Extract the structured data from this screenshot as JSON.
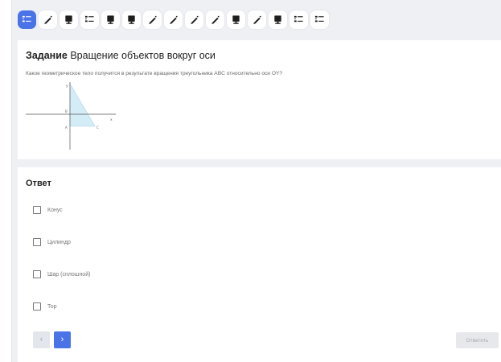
{
  "toolbar": {
    "tools": [
      {
        "icon": "checklist-icon",
        "active": true
      },
      {
        "icon": "pen-icon",
        "active": false
      },
      {
        "icon": "monitor-icon",
        "active": false
      },
      {
        "icon": "checklist-icon",
        "active": false
      },
      {
        "icon": "monitor-icon",
        "active": false
      },
      {
        "icon": "monitor-icon",
        "active": false
      },
      {
        "icon": "pen-icon",
        "active": false
      },
      {
        "icon": "pen-icon",
        "active": false
      },
      {
        "icon": "pen-icon",
        "active": false
      },
      {
        "icon": "pen-icon",
        "active": false
      },
      {
        "icon": "monitor-icon",
        "active": false
      },
      {
        "icon": "pen-icon",
        "active": false
      },
      {
        "icon": "monitor-icon",
        "active": false
      },
      {
        "icon": "checklist-icon",
        "active": false
      },
      {
        "icon": "checklist-icon",
        "active": false
      }
    ],
    "accent_color": "#4a73e8"
  },
  "task": {
    "label": "Задание",
    "title": "Вращение объектов вокруг оси",
    "question": "Какое геометрическое тело получится в результате вращения треугольника ABC относительно оси OY?",
    "figure": {
      "y_axis_label": "y",
      "x_axis_label": "x",
      "point_a": "B",
      "point_b": "A",
      "point_c": "C"
    }
  },
  "answer": {
    "title": "Ответ",
    "options": [
      "Конус",
      "Цилиндр",
      "Шар (сплошной)",
      "Тор"
    ],
    "prev_label": "‹",
    "next_label": "›",
    "submit_label": "Ответить"
  }
}
